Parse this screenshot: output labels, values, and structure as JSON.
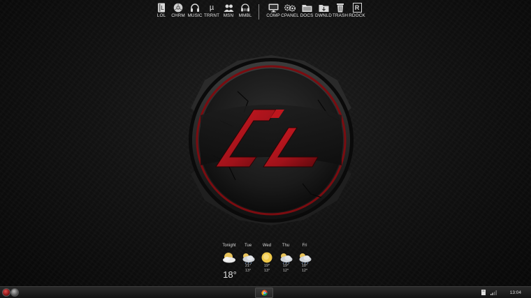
{
  "dock": {
    "left_items": [
      {
        "label": "LOL",
        "icon": "book-icon"
      },
      {
        "label": "CHRM",
        "icon": "chrome-icon"
      },
      {
        "label": "MUSIC",
        "icon": "headphones-icon"
      },
      {
        "label": "TRRNT",
        "icon": "utorrent-icon",
        "glyph": "µ"
      },
      {
        "label": "MSN",
        "icon": "msn-people-icon"
      },
      {
        "label": "MMBL",
        "icon": "mumble-icon"
      }
    ],
    "right_items": [
      {
        "label": "COMP",
        "icon": "monitor-icon"
      },
      {
        "label": "CPANEL",
        "icon": "gears-icon"
      },
      {
        "label": "DOCS",
        "icon": "folder-icon"
      },
      {
        "label": "DWNLD",
        "icon": "download-folder-icon"
      },
      {
        "label": "TRASH",
        "icon": "trash-icon"
      },
      {
        "label": "RDOCK",
        "icon": "rdock-icon",
        "glyph": "R"
      }
    ]
  },
  "logo": {
    "text": "AL",
    "accent": "#b3141b"
  },
  "weather": {
    "now_temp": "18°",
    "days": [
      {
        "name": "Tonight",
        "icon": "moon-cloud-icon"
      },
      {
        "name": "Tue",
        "icon": "cloud-sun-icon",
        "hi": "21°",
        "lo": "13°"
      },
      {
        "name": "Wed",
        "icon": "sun-icon",
        "hi": "19°",
        "lo": "13°"
      },
      {
        "name": "Thu",
        "icon": "cloud-sun-icon",
        "hi": "19°",
        "lo": "12°"
      },
      {
        "name": "Fri",
        "icon": "cloud-sun-icon",
        "hi": "18°",
        "lo": "12°"
      }
    ]
  },
  "taskbar": {
    "start_icon": "start-orb-icon",
    "pinned": [
      "chrome-icon"
    ],
    "tray_icons": [
      "notification-icon",
      "network-signal-icon"
    ],
    "clock": "13:04"
  },
  "colors": {
    "accent_red": "#b3141b",
    "background": "#0b0b0b",
    "text": "#e6e6e6"
  }
}
